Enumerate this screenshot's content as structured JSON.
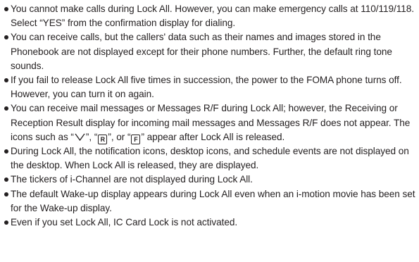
{
  "items": [
    {
      "text": "You cannot make calls during Lock All. However, you can make emergency calls at 110/119/118. Select “YES” from the confirmation display for dialing."
    },
    {
      "text": "You can receive calls, but the callers' data such as their names and images stored in the Phonebook are not displayed except for their phone numbers. Further, the default ring tone sounds."
    },
    {
      "text": "If you fail to release Lock All five times in succession, the power to the FOMA phone turns off. However, you can turn it on again."
    },
    {
      "text_a": "You can receive mail messages or Messages R/F during Lock All; however, the Receiving or Reception Result display for incoming mail messages and Messages R/F does not appear. The icons such as “",
      "icon_1": "mail-envelope-icon",
      "text_b": "”, “",
      "icon_2_letter": "R",
      "text_c": "”, or “",
      "icon_3_letter": "F",
      "text_d": "” appear after Lock All is released."
    },
    {
      "text": "During Lock All, the notification icons, desktop icons, and schedule events are not displayed on the desktop. When Lock All is released, they are displayed."
    },
    {
      "text": "The tickers of i-Channel are not displayed during Lock All."
    },
    {
      "text": "The default Wake-up display appears during Lock All even when an i-motion movie has been set for the Wake-up display."
    },
    {
      "text": "Even if you set Lock All, IC Card Lock is not activated."
    }
  ]
}
